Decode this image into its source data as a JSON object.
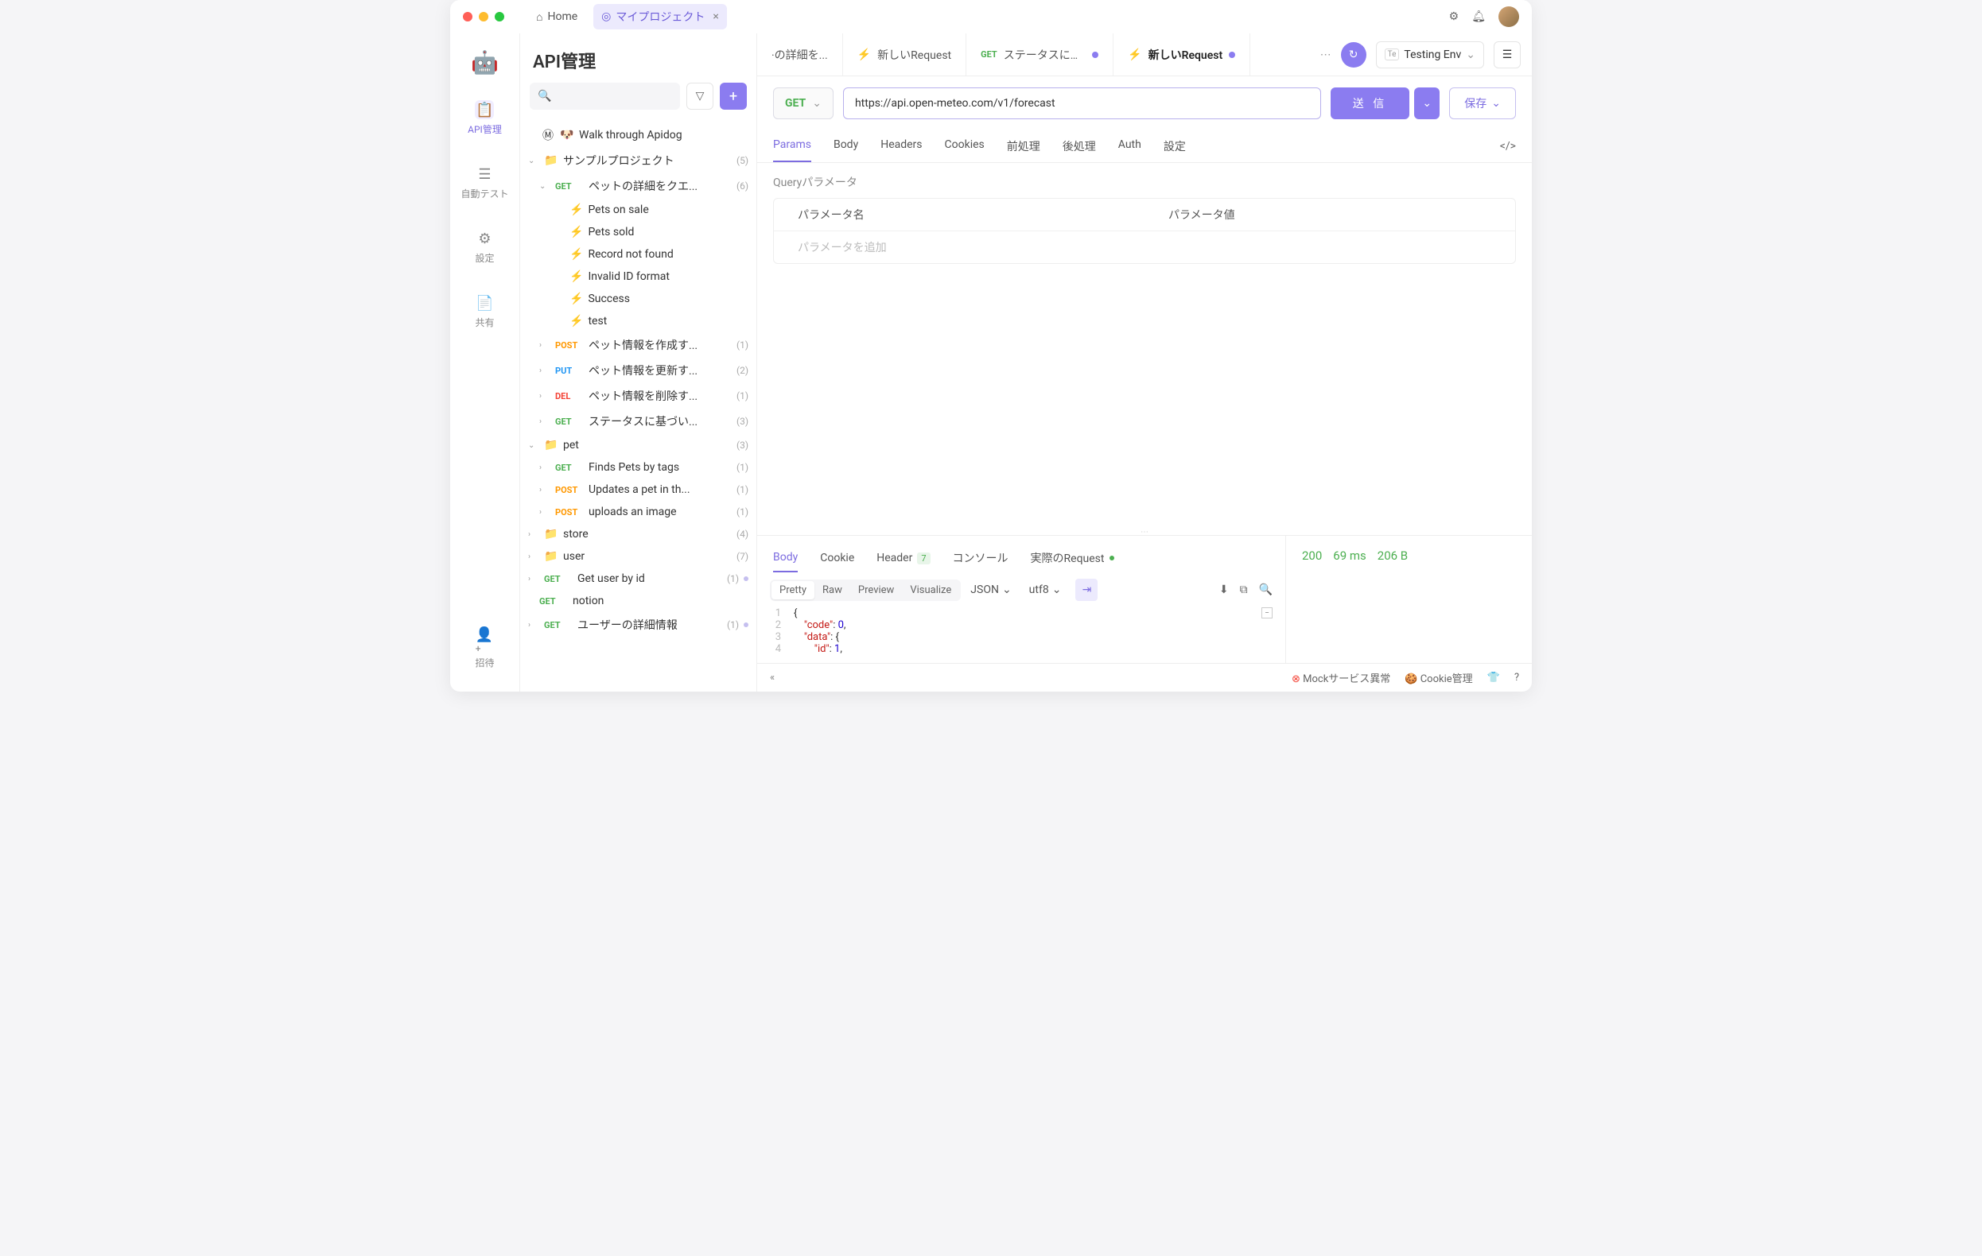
{
  "titlebar": {
    "home": "Home",
    "project_tab": "マイプロジェクト"
  },
  "leftnav": {
    "api": "API管理",
    "autotest": "自動テスト",
    "settings": "設定",
    "share": "共有",
    "invite": "招待"
  },
  "sidebar": {
    "title": "API管理",
    "walk": "Walk through Apidog",
    "sample_project": "サンプルプロジェクト",
    "sample_count": "(5)",
    "pet_detail": "ペットの詳細をクエ...",
    "pet_detail_count": "(6)",
    "cases": {
      "sale": "Pets on sale",
      "sold": "Pets sold",
      "notfound": "Record not found",
      "invalid": "Invalid ID format",
      "success": "Success",
      "test": "test"
    },
    "post_create": "ペット情報を作成す...",
    "post_create_count": "(1)",
    "put_update": "ペット情報を更新す...",
    "put_update_count": "(2)",
    "del_delete": "ペット情報を削除す...",
    "del_delete_count": "(1)",
    "get_status": "ステータスに基づい...",
    "get_status_count": "(3)",
    "pet": "pet",
    "pet_count": "(3)",
    "finds_tags": "Finds Pets by tags",
    "finds_tags_count": "(1)",
    "updates_pet": "Updates a pet in th...",
    "updates_pet_count": "(1)",
    "uploads_image": "uploads an image",
    "uploads_image_count": "(1)",
    "store": "store",
    "store_count": "(4)",
    "user": "user",
    "user_count": "(7)",
    "get_user_by_id": "Get user by id",
    "get_user_by_id_count": "(1)",
    "notion": "notion",
    "user_detail": "ユーザーの詳細情報",
    "user_detail_count": "(1)"
  },
  "methods": {
    "get": "GET",
    "post": "POST",
    "put": "PUT",
    "del": "DEL"
  },
  "tabs": {
    "t1": "·の詳細を...",
    "t2": "新しいRequest",
    "t3": "ステータスに基...",
    "t4": "新しいRequest"
  },
  "env": "Testing Env",
  "request": {
    "method": "GET",
    "url": "https://api.open-meteo.com/v1/forecast",
    "send": "送 信",
    "save": "保存"
  },
  "req_tabs": {
    "params": "Params",
    "body": "Body",
    "headers": "Headers",
    "cookies": "Cookies",
    "pre": "前処理",
    "post": "後処理",
    "auth": "Auth",
    "settings": "設定"
  },
  "params": {
    "title": "Queryパラメータ",
    "name_h": "パラメータ名",
    "value_h": "パラメータ値",
    "add": "パラメータを追加"
  },
  "resp_tabs": {
    "body": "Body",
    "cookie": "Cookie",
    "header": "Header",
    "header_count": "7",
    "console": "コンソール",
    "actual": "実際のRequest"
  },
  "resp_seg": {
    "pretty": "Pretty",
    "raw": "Raw",
    "preview": "Preview",
    "visualize": "Visualize"
  },
  "resp_fmt": {
    "json": "JSON",
    "utf8": "utf8"
  },
  "status": {
    "code": "200",
    "time": "69 ms",
    "size": "206 B"
  },
  "footer": {
    "mock_err": "Mockサービス異常",
    "cookie": "Cookie管理"
  },
  "code_lines": [
    "{",
    "  \"code\": 0,",
    "  \"data\": {",
    "    \"id\": 1,"
  ]
}
